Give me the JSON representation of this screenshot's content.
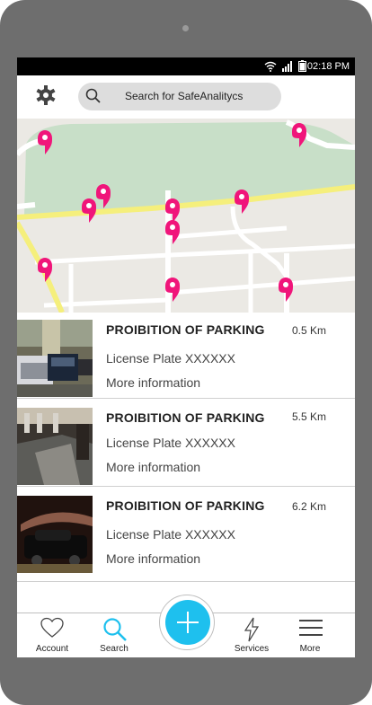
{
  "status": {
    "time": "02:18 PM"
  },
  "search": {
    "placeholder": "Search for SafeAnalitycs"
  },
  "results": [
    {
      "title": "PROIBITION OF PARKING",
      "distance": "0.5 Km",
      "plate": "License Plate XXXXXX",
      "more": "More information"
    },
    {
      "title": "PROIBITION OF PARKING",
      "distance": "5.5 Km",
      "plate": "License Plate XXXXXX",
      "more": "More information"
    },
    {
      "title": "PROIBITION OF PARKING",
      "distance": "6.2 Km",
      "plate": "License Plate XXXXXX",
      "more": "More information"
    }
  ],
  "nav": {
    "account": "Account",
    "search": "Search",
    "services": "Services",
    "more": "More"
  },
  "colors": {
    "pin": "#f0157a",
    "accent": "#1ec0ee",
    "park": "#c8dfc8",
    "road_major": "#f5ef7c"
  }
}
